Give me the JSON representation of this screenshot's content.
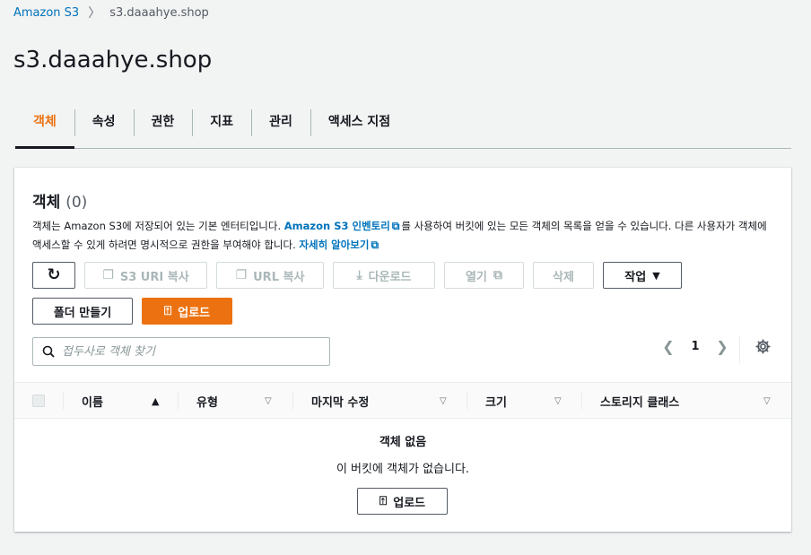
{
  "breadcrumb": {
    "root": "Amazon S3",
    "current": "s3.daaahye.shop"
  },
  "page_title": "s3.daaahye.shop",
  "tabs": [
    {
      "label": "객체"
    },
    {
      "label": "속성"
    },
    {
      "label": "권한"
    },
    {
      "label": "지표"
    },
    {
      "label": "관리"
    },
    {
      "label": "액세스 지점"
    }
  ],
  "panel": {
    "title": "객체",
    "count": "(0)",
    "desc_part1": "객체는 Amazon S3에 저장되어 있는 기본 엔터티입니다. ",
    "desc_link1": "Amazon S3 인벤토리",
    "desc_part2": "를 사용하여 버킷에 있는 모든 객체의 목록을 얻을 수 있습니다. 다른 사용자가 객체에 액세스할 수 있게 하려면 명시적으로 권한을 부여해야 합니다. ",
    "desc_link2": "자세히 알아보기"
  },
  "toolbar": {
    "refresh_icon": "↻",
    "copy_s3_uri": "S3 URI 복사",
    "copy_url": "URL 복사",
    "download": "다운로드",
    "open": "열기",
    "delete": "삭제",
    "actions": "작업",
    "create_folder": "폴더 만들기",
    "upload": "업로드"
  },
  "search": {
    "placeholder": "접두사로 객체 찾기"
  },
  "pagination": {
    "page": "1"
  },
  "table": {
    "columns": [
      "이름",
      "유형",
      "마지막 수정",
      "크기",
      "스토리지 클래스"
    ]
  },
  "empty": {
    "title": "객체 없음",
    "desc": "이 버킷에 객체가 없습니다.",
    "upload": "업로드"
  },
  "colors": {
    "accent": "#ec7211",
    "link": "#0073bb"
  }
}
